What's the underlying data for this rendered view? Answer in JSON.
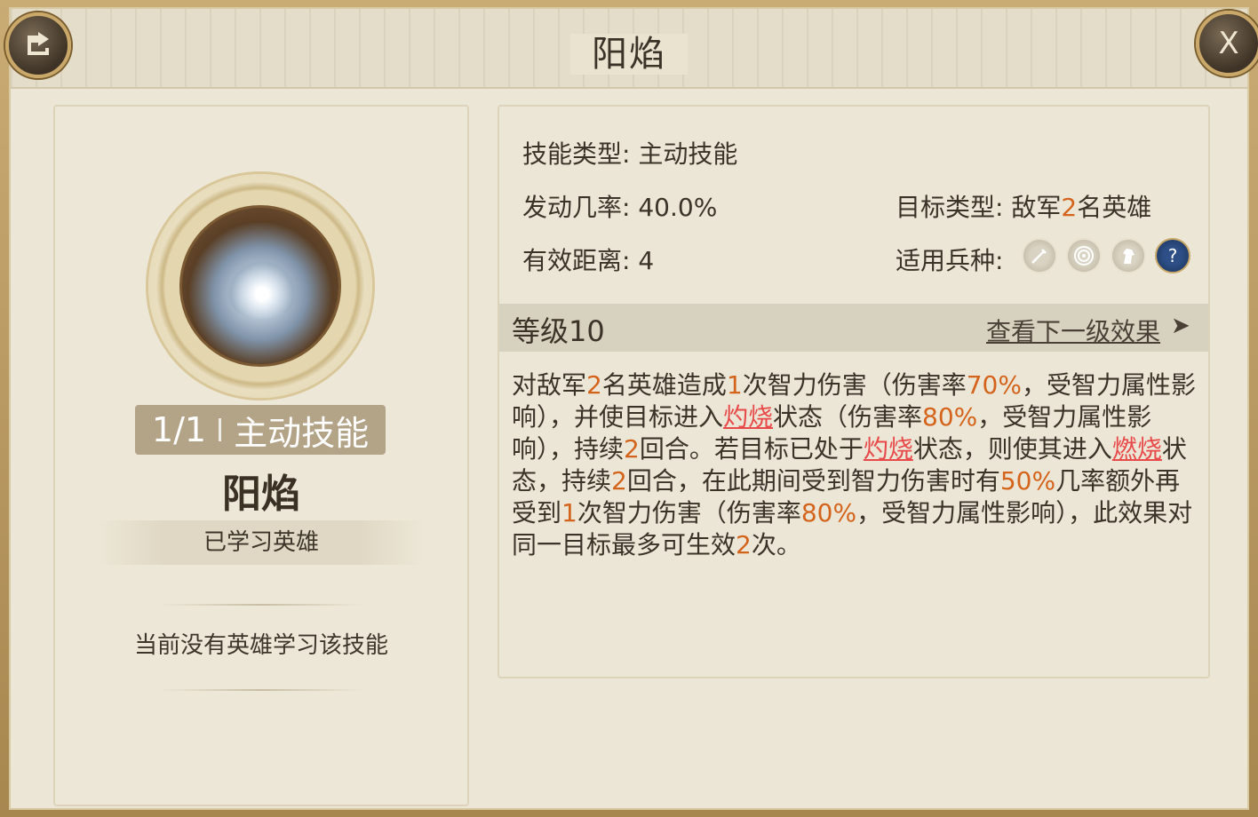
{
  "header": {
    "title": "阳焰",
    "close_label": "X"
  },
  "skill": {
    "count": "1/1",
    "type_tag": "主动技能",
    "name": "阳焰",
    "learned_label": "已学习英雄",
    "no_learner_text": "当前没有英雄学习该技能"
  },
  "stats": {
    "type_label": "技能类型:",
    "type_value": "主动技能",
    "chance_label": "发动几率:",
    "chance_value": "40.0%",
    "range_label": "有效距离:",
    "range_value": "4",
    "target_label": "目标类型:",
    "target_prefix": "敌军",
    "target_num": "2",
    "target_suffix": "名英雄",
    "troop_label": "适用兵种:",
    "troop_icons": [
      "sword-icon",
      "target-icon",
      "horse-icon",
      "question-icon"
    ],
    "unknown_icon": "?"
  },
  "level": {
    "label": "等级10",
    "next_label": "查看下一级效果",
    "next_arrow": "➤"
  },
  "description": {
    "parts": [
      {
        "t": "对敌军",
        "c": "n"
      },
      {
        "t": "2",
        "c": "o"
      },
      {
        "t": "名英雄造成",
        "c": "n"
      },
      {
        "t": "1",
        "c": "o"
      },
      {
        "t": "次智力伤害（伤害率",
        "c": "n"
      },
      {
        "t": "70%",
        "c": "o"
      },
      {
        "t": "，受智力属性影响），并使目标进入",
        "c": "n"
      },
      {
        "t": "灼烧",
        "c": "r"
      },
      {
        "t": "状态（伤害率",
        "c": "n"
      },
      {
        "t": "80%",
        "c": "o"
      },
      {
        "t": "，受智力属性影响），持续",
        "c": "n"
      },
      {
        "t": "2",
        "c": "o"
      },
      {
        "t": "回合。若目标已处于",
        "c": "n"
      },
      {
        "t": "灼烧",
        "c": "r"
      },
      {
        "t": "状态，则使其进入",
        "c": "n"
      },
      {
        "t": "燃烧",
        "c": "r"
      },
      {
        "t": "状态，持续",
        "c": "n"
      },
      {
        "t": "2",
        "c": "o"
      },
      {
        "t": "回合，在此期间受到智力伤害时有",
        "c": "n"
      },
      {
        "t": "50%",
        "c": "o"
      },
      {
        "t": "几率额外再受到",
        "c": "n"
      },
      {
        "t": "1",
        "c": "o"
      },
      {
        "t": "次智力伤害（伤害率",
        "c": "n"
      },
      {
        "t": "80%",
        "c": "o"
      },
      {
        "t": "，受智力属性影响），此效果对同一目标最多可生效",
        "c": "n"
      },
      {
        "t": "2",
        "c": "o"
      },
      {
        "t": "次。",
        "c": "n"
      }
    ]
  },
  "colors": {
    "highlight": "#d4641b",
    "status_link": "#e84a4a",
    "text": "#3b3328"
  }
}
